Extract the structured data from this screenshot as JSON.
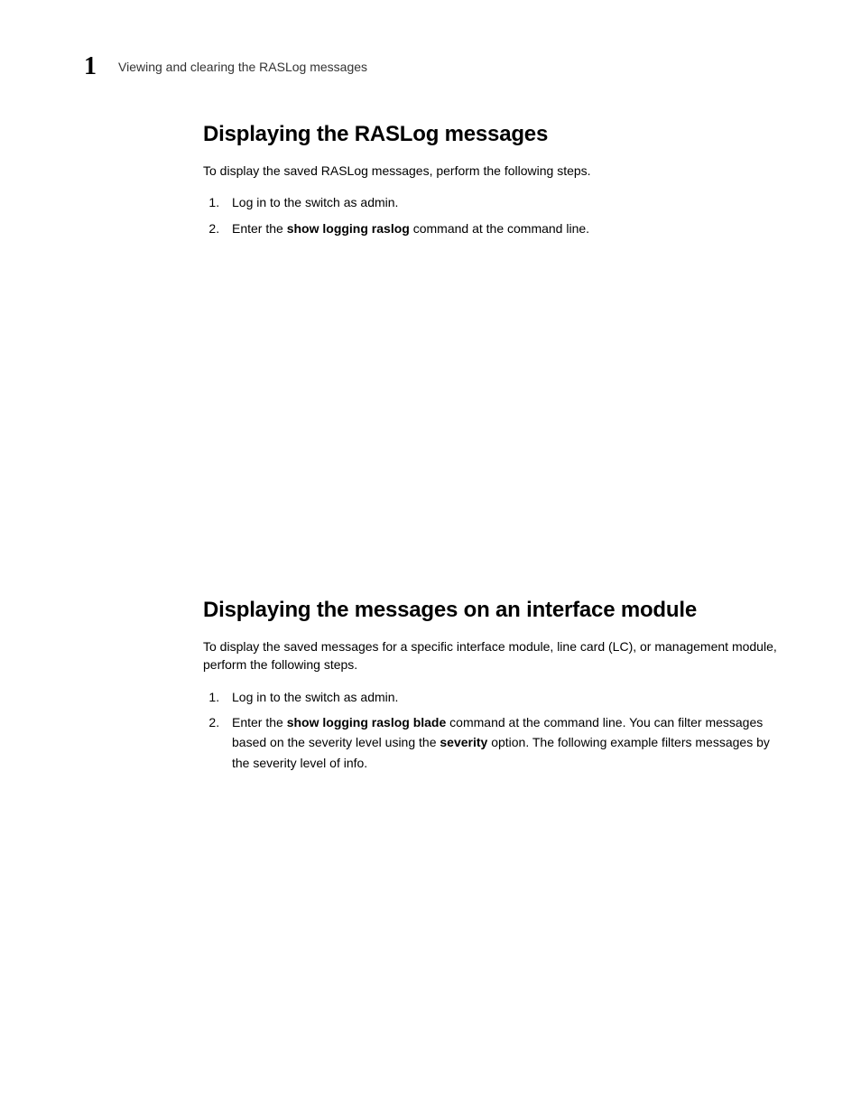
{
  "header": {
    "chapter_number": "1",
    "title": "Viewing and clearing the RASLog messages"
  },
  "section1": {
    "heading": "Displaying the RASLog messages",
    "intro": "To display the saved RASLog messages, perform the following steps.",
    "step1": "Log in to the switch as admin.",
    "step2_pre": "Enter the ",
    "step2_cmd": "show logging raslog",
    "step2_post": " command at the command line."
  },
  "section2": {
    "heading": "Displaying the messages on an interface module",
    "intro": "To display the saved messages for a specific interface module, line card (LC), or management module, perform the following steps.",
    "step1": "Log in to the switch as admin.",
    "step2_pre": "Enter the ",
    "step2_cmd": "show logging raslog blade",
    "step2_mid1": " command at the command line. You can filter messages based on the severity level using the ",
    "step2_opt": "severity",
    "step2_mid2": " option. The following example filters messages by the severity level of info."
  }
}
